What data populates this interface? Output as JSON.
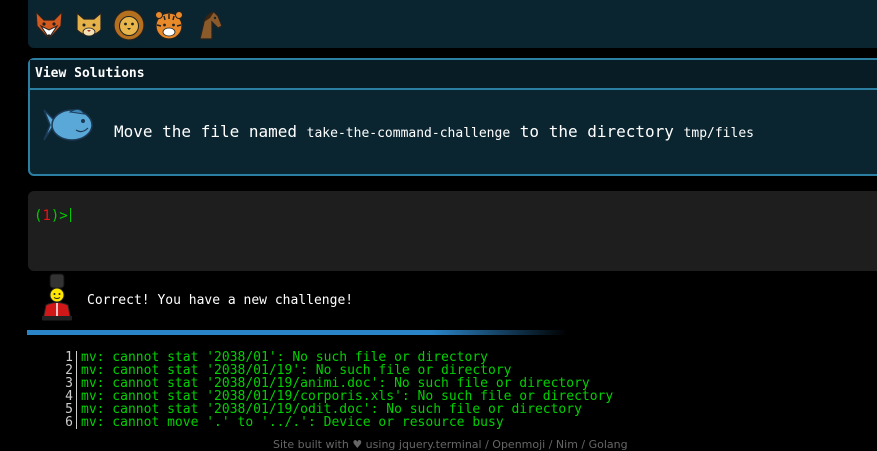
{
  "animals": [
    "fox-icon",
    "cat-icon",
    "lion-icon",
    "tiger-icon",
    "horse-icon"
  ],
  "challenge": {
    "header": "View Solutions",
    "text_prefix": "Move the file named ",
    "file_name": "take-the-command-challenge",
    "text_middle": " to the directory ",
    "dir_name": "tmp/files"
  },
  "terminal": {
    "prompt_open": "(",
    "prompt_number": "1",
    "prompt_close": ")>"
  },
  "feedback": {
    "message": "Correct! You have a new challenge!"
  },
  "output": [
    {
      "n": "1",
      "text": "mv: cannot stat '2038/01': No such file or directory"
    },
    {
      "n": "2",
      "text": "mv: cannot stat '2038/01/19': No such file or directory"
    },
    {
      "n": "3",
      "text": "mv: cannot stat '2038/01/19/animi.doc': No such file or directory"
    },
    {
      "n": "4",
      "text": "mv: cannot stat '2038/01/19/corporis.xls': No such file or directory"
    },
    {
      "n": "5",
      "text": "mv: cannot stat '2038/01/19/odit.doc': No such file or directory"
    },
    {
      "n": "6",
      "text": "mv: cannot move '.' to '../.': Device or resource busy"
    }
  ],
  "footer": {
    "text": "Site built with ♥ using jquery.terminal / Openmoji / Nim / Golang"
  },
  "colors": {
    "accent": "#2b7fa3",
    "output_green": "#00d000",
    "prompt_green": "#00cc00",
    "prompt_red": "#ee1111"
  }
}
